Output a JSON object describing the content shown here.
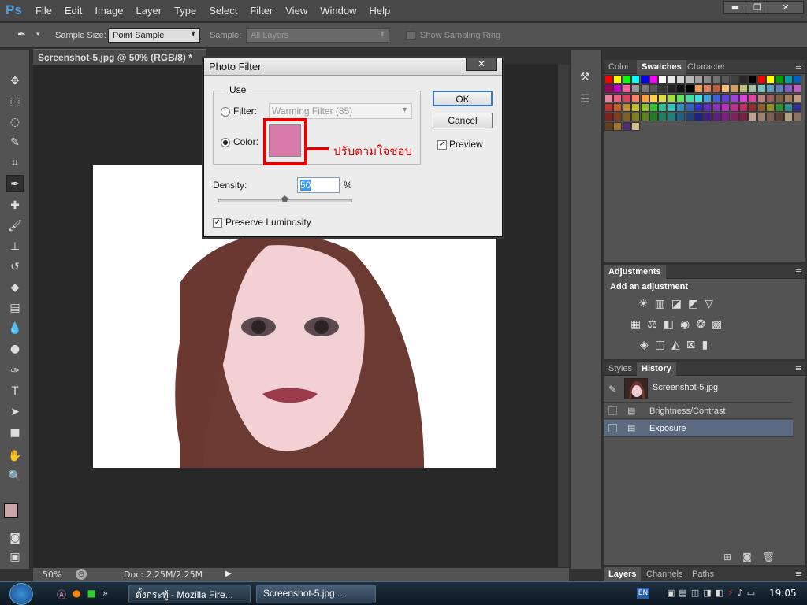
{
  "app": {
    "logo": "Ps"
  },
  "menu": [
    "File",
    "Edit",
    "Image",
    "Layer",
    "Type",
    "Select",
    "Filter",
    "View",
    "Window",
    "Help"
  ],
  "window_controls": {
    "minimize": "▬",
    "restore": "❐",
    "close": "✕"
  },
  "options": {
    "sample_size_label": "Sample Size:",
    "sample_size_value": "Point Sample",
    "sample_label": "Sample:",
    "sample_value": "All Layers",
    "sampling_ring_label": "Show Sampling Ring"
  },
  "document": {
    "tab_title": "Screenshot-5.jpg @ 50% (RGB/8) *",
    "close_glyph": "×",
    "zoom": "50%",
    "doc_info": "Doc: 2.25M/2.25M"
  },
  "dialog": {
    "title": "Photo Filter",
    "close_glyph": "✕",
    "use_label": "Use",
    "filter_label": "Filter:",
    "filter_value": "Warming Filter (85)",
    "color_label": "Color:",
    "color_value": "#d87aaa",
    "annotation": "ปรับตามใจชอบ",
    "density_label": "Density:",
    "density_value": "50",
    "density_unit": "%",
    "density_fraction": 0.5,
    "preserve_label": "Preserve Luminosity",
    "ok": "OK",
    "cancel": "Cancel",
    "preview_label": "Preview"
  },
  "panels": {
    "top_tabs": [
      "Color",
      "Swatches",
      "Character"
    ],
    "adjustments_title": "Adjustments",
    "adjustments_hint": "Add an adjustment",
    "history_tabs": [
      "Styles",
      "History"
    ],
    "history_snapshot": "Screenshot-5.jpg",
    "history_items": [
      "Brightness/Contrast",
      "Exposure"
    ],
    "bottom_tabs": [
      "Layers",
      "Channels",
      "Paths"
    ]
  },
  "taskbar": {
    "firefox_label": "ตั้งกระทู้ - Mozilla Fire...",
    "ps_label": "Screenshot-5.jpg ...",
    "lang": "EN",
    "clock": "19:05"
  },
  "colors": {
    "accent": "#3a76c6",
    "annotation": "#e00000",
    "selected_color": "#d87aaa"
  }
}
